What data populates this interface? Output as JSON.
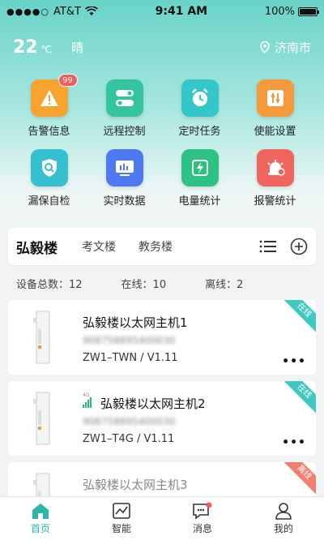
{
  "status_bar": {
    "carrier": "AT&T",
    "time": "9:41 AM",
    "battery": "100%"
  },
  "weather": {
    "temp": "22",
    "unit": "℃",
    "condition": "晴",
    "city": "济南市"
  },
  "shortcuts": [
    {
      "label": "告警信息",
      "icon": "warning-icon",
      "color": "#f7a32f",
      "badge": "99"
    },
    {
      "label": "远程控制",
      "icon": "toggle-icon",
      "color": "#35c4a0"
    },
    {
      "label": "定时任务",
      "icon": "alarm-clock-icon",
      "color": "#33c7c9"
    },
    {
      "label": "使能设置",
      "icon": "sliders-icon",
      "color": "#f59a3b"
    },
    {
      "label": "漏保自检",
      "icon": "shield-search-icon",
      "color": "#35bfcf"
    },
    {
      "label": "实时数据",
      "icon": "monitor-icon",
      "color": "#4f79f3"
    },
    {
      "label": "电量统计",
      "icon": "energy-icon",
      "color": "#2dc283"
    },
    {
      "label": "报警统计",
      "icon": "siren-icon",
      "color": "#f0655d"
    }
  ],
  "buildings": {
    "tabs": [
      "弘毅楼",
      "考文楼",
      "教务楼"
    ],
    "active": "弘毅楼"
  },
  "stats": {
    "total": "设备总数：12",
    "online": "在线：10",
    "offline": "离线：2"
  },
  "devices": [
    {
      "name": "弘毅楼以太网主机1",
      "serial": "908758895400030",
      "model": "ZW1–TWN / V1.11",
      "status": "在线",
      "status_color": "#3ec8c0"
    },
    {
      "name": "弘毅楼以太网主机2",
      "serial": "908758895400030",
      "model": "ZW1–T4G / V1.11",
      "status": "在线",
      "status_color": "#3ec8c0",
      "network": "4G"
    },
    {
      "name": "弘毅楼以太网主机3",
      "serial": "",
      "model": "",
      "status": "离线",
      "status_color": "#f07f6e"
    }
  ],
  "tabbar": [
    {
      "label": "首页",
      "icon": "home-icon",
      "active": true
    },
    {
      "label": "智能",
      "icon": "chart-icon",
      "active": false
    },
    {
      "label": "消息",
      "icon": "message-icon",
      "active": false
    },
    {
      "label": "我的",
      "icon": "user-icon",
      "active": false
    }
  ],
  "more_label": "•••"
}
